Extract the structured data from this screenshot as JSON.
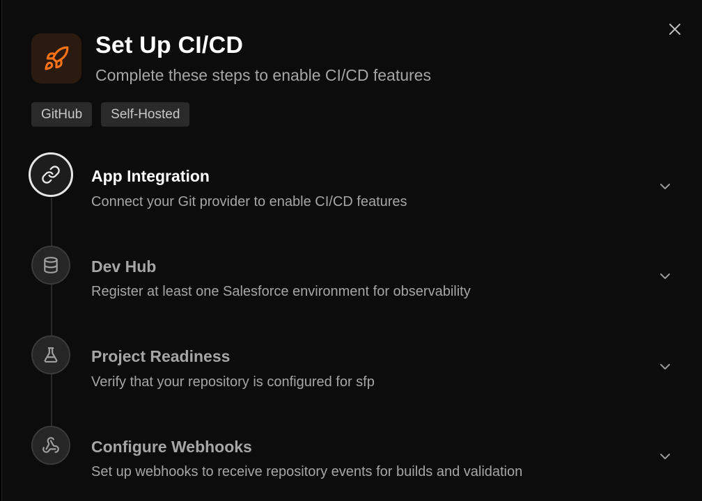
{
  "dialog": {
    "title": "Set Up CI/CD",
    "subtitle": "Complete these steps to enable CI/CD features",
    "icon": "rocket-icon",
    "accent_color": "#f97316",
    "tags": [
      "GitHub",
      "Self-Hosted"
    ]
  },
  "steps": [
    {
      "title": "App Integration",
      "description": "Connect your Git provider to enable CI/CD features",
      "icon": "link-icon",
      "active": true
    },
    {
      "title": "Dev Hub",
      "description": "Register at least one Salesforce environment for observability",
      "icon": "database-icon",
      "active": false
    },
    {
      "title": "Project Readiness",
      "description": "Verify that your repository is configured for sfp",
      "icon": "flask-icon",
      "active": false
    },
    {
      "title": "Configure Webhooks",
      "description": "Set up webhooks to receive repository events for builds and validation",
      "icon": "webhook-icon",
      "active": false
    }
  ]
}
